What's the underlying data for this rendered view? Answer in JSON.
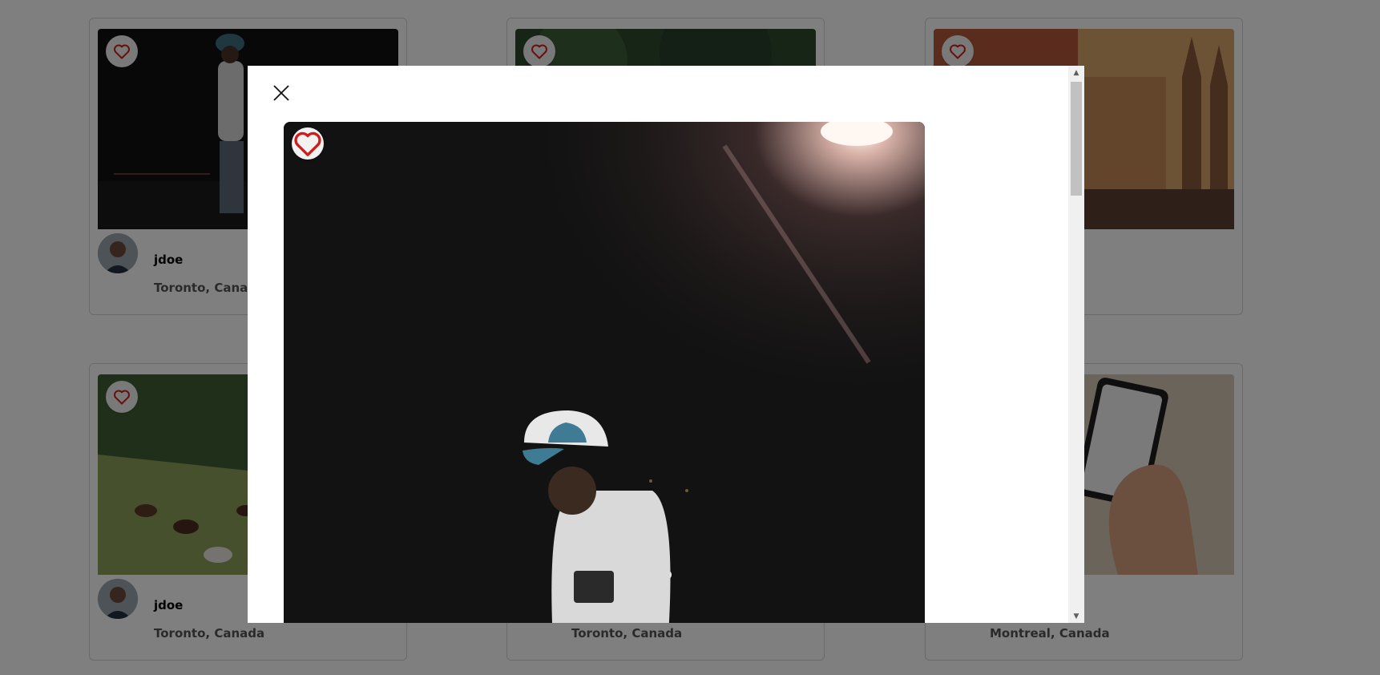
{
  "cards": [
    {
      "username": "jdoe",
      "location": "Toronto, Canada"
    },
    {
      "username": "",
      "location": ""
    },
    {
      "username": "",
      "location": ""
    },
    {
      "username": "jdoe",
      "location": "Toronto, Canada"
    },
    {
      "username": "",
      "location": "Toronto, Canada"
    },
    {
      "username": "",
      "location": "Montreal, Canada"
    }
  ],
  "icons": {
    "favorite": "heart-icon",
    "close": "close-icon",
    "scroll_up": "▲",
    "scroll_down": "▼"
  },
  "colors": {
    "heart": "#d01c1c",
    "overlay": "rgba(0,0,0,0.5)"
  }
}
